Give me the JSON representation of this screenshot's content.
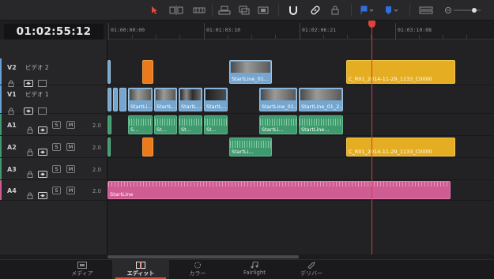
{
  "timecode": "01:02:55:12",
  "ruler": {
    "labels": [
      "01:00:00:00",
      "01:01:03:10",
      "01:02:06:21",
      "01:03:10:08"
    ]
  },
  "toolbar": {
    "icons": [
      "selection-arrow-icon",
      "trim-icon",
      "blade-icon",
      "insert-icon",
      "overwrite-icon",
      "replace-icon",
      "snapping-icon",
      "link-icon",
      "lock-icon",
      "flag-icon",
      "marker-icon",
      "zoom-icon",
      "zoom-slider"
    ],
    "accent_color": "#e24b3a",
    "flag_color": "#2f6fe0"
  },
  "tracks": [
    {
      "id": "V2",
      "name": "ビデオ 2",
      "type": "video",
      "color": "#6aa0d6"
    },
    {
      "id": "V1",
      "name": "ビデオ 1",
      "type": "video",
      "color": "#6aa0d6"
    },
    {
      "id": "A1",
      "name": "",
      "type": "audio",
      "volume": "2.0",
      "color": "#3f9a6e"
    },
    {
      "id": "A2",
      "name": "",
      "type": "audio",
      "volume": "2.0",
      "color": "#3f9a6e"
    },
    {
      "id": "A3",
      "name": "",
      "type": "audio",
      "volume": "2.0",
      "color": "#3f9a6e"
    },
    {
      "id": "A4",
      "name": "",
      "type": "audio",
      "volume": "2.0",
      "color": "#cf5c92"
    }
  ],
  "track_buttons": {
    "solo": "S",
    "mute": "M"
  },
  "clips": {
    "v2_a": "StartLine_01...",
    "v2_b": "C_R01_2014-11-29_1133_C0000",
    "v1_a": "StartLi...",
    "v1_b": "StartL...",
    "v1_c": "StartL...",
    "v1_d": "StartL...",
    "v1_e": "StartLine_01...",
    "v1_f": "StartLine_01_2...",
    "a1_a": "S...",
    "a1_b": "St...",
    "a1_c": "St...",
    "a1_d": "St...",
    "a1_e": "StartLi...",
    "a1_f": "StartLine...",
    "a2_a": "StartLi...",
    "a2_b": "C_R01_2014-11-29_1133_C0000",
    "a4_a": "StartLine"
  },
  "pages": [
    {
      "label": "メディア",
      "icon": "media-icon",
      "active": false
    },
    {
      "label": "エディット",
      "icon": "edit-icon",
      "active": true
    },
    {
      "label": "カラー",
      "icon": "color-icon",
      "active": false
    },
    {
      "label": "Fairlight",
      "icon": "fairlight-icon",
      "active": false
    },
    {
      "label": "デリバー",
      "icon": "deliver-icon",
      "active": false
    }
  ]
}
